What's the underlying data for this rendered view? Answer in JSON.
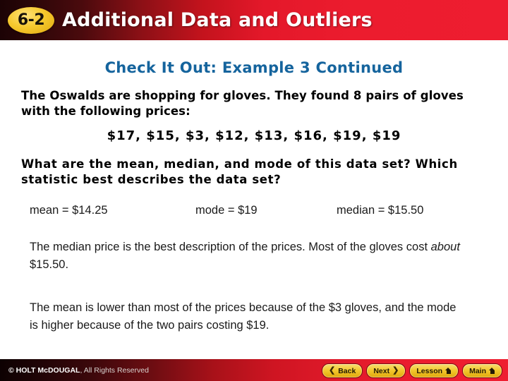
{
  "header": {
    "lesson_number": "6-2",
    "title": "Additional Data and Outliers",
    "badge_color": "#f3c92f",
    "bar_color": "#ee1d30"
  },
  "slide": {
    "subtitle": "Check It Out: Example 3 Continued",
    "subtitle_color": "#15649d",
    "intro_paragraph": "The Oswalds are shopping for gloves. They found 8 pairs of gloves with the following prices:",
    "prices_line": "$17, $15, $3, $12, $13, $16, $19, $19",
    "question_paragraph": "What are the mean, median, and mode of this data set? Which statistic best describes the data set?",
    "answers": [
      {
        "label": "mean",
        "text": "mean = $14.25"
      },
      {
        "label": "mode",
        "text": "mode = $19"
      },
      {
        "label": "median",
        "text": "median = $15.50"
      }
    ],
    "explanation_1_part1": "The median price is the best description of the prices. Most of the gloves cost ",
    "explanation_1_emphasis": "about",
    "explanation_1_part2": " $15.50.",
    "explanation_2": "The mean is lower than most of the prices because of the $3 gloves, and the mode is higher because of the two pairs costing $19."
  },
  "footer": {
    "copyright_mark": "© HOLT McDOUGAL",
    "copyright_rest": ", All Rights Reserved",
    "buttons": [
      {
        "label": "Back",
        "icon": "chevron-left-icon",
        "glyph": "❮"
      },
      {
        "label": "Next",
        "icon": "chevron-right-icon",
        "glyph": "❯"
      },
      {
        "label": "Lesson",
        "icon": "home-icon",
        "glyph": ""
      },
      {
        "label": "Main",
        "icon": "home-icon",
        "glyph": ""
      }
    ]
  }
}
